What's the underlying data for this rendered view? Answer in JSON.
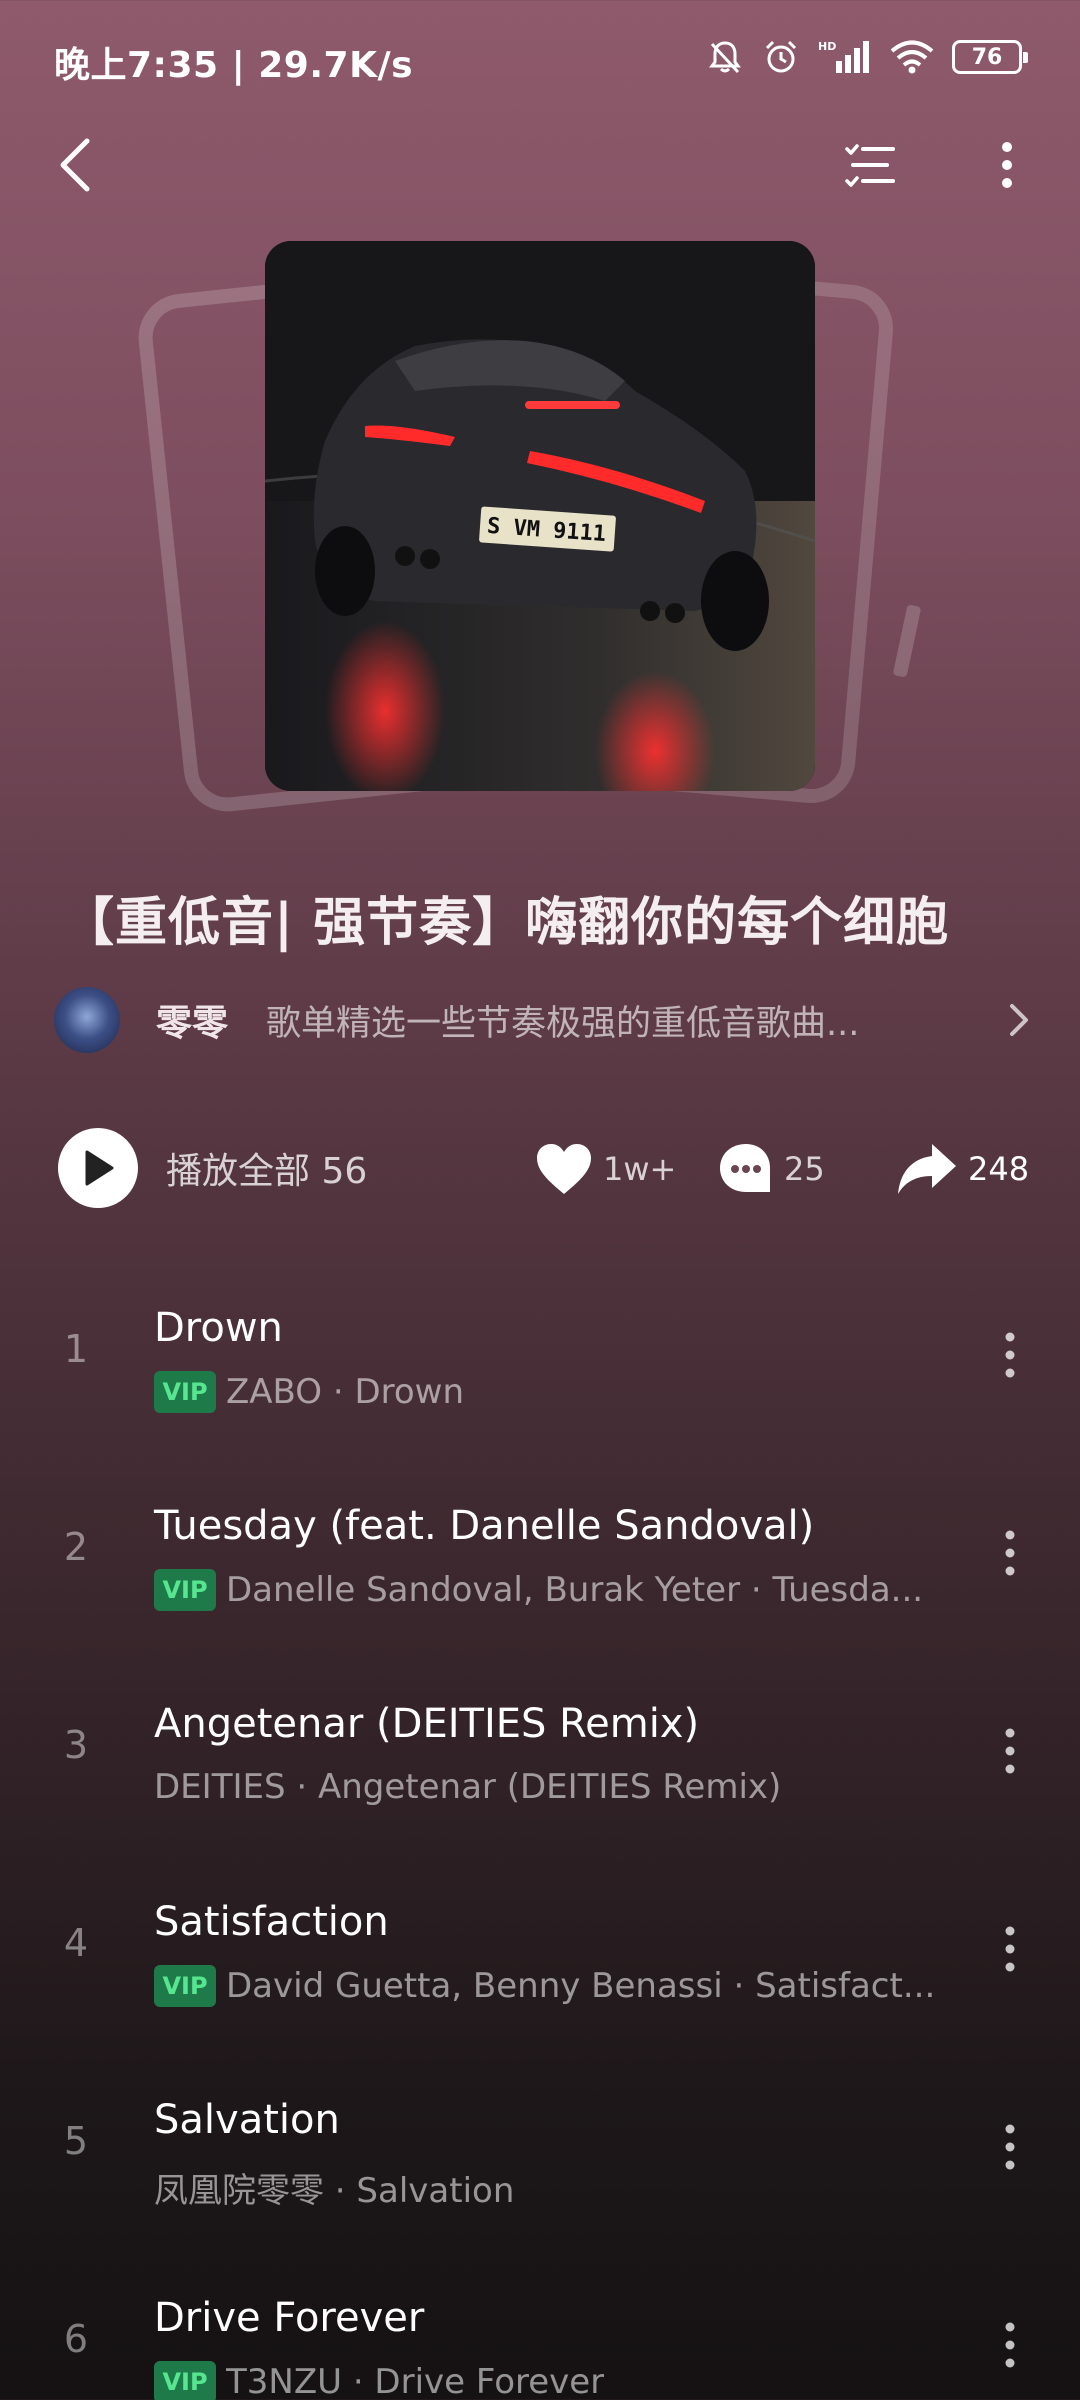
{
  "status_bar": {
    "time_speed": "晚上7:35 | 29.7K/s",
    "battery": "76",
    "hd": "HD"
  },
  "nav": {
    "back_icon": "chevron-left-icon",
    "list_icon": "list-check-icon",
    "more_icon": "more-vertical-icon"
  },
  "playlist": {
    "title": "【重低音| 强节奏】嗨翻你的每个细胞",
    "creator_name": "零零",
    "description": "歌单精选一些节奏极强的重低音歌曲...",
    "plate": "S VM 9111"
  },
  "actions": {
    "play_all_label": "播放全部",
    "track_count": "56",
    "likes": "1w+",
    "comments": "25",
    "shares": "248"
  },
  "songs": [
    {
      "index": "1",
      "title": "Drown",
      "vip": true,
      "meta": "ZABO · Drown"
    },
    {
      "index": "2",
      "title": "Tuesday (feat. Danelle Sandoval)",
      "vip": true,
      "meta": "Danelle Sandoval, Burak Yeter · Tuesda..."
    },
    {
      "index": "3",
      "title": "Angetenar (DEITIES Remix)",
      "vip": false,
      "meta": "DEITIES · Angetenar (DEITIES Remix)"
    },
    {
      "index": "4",
      "title": "Satisfaction",
      "vip": true,
      "meta": "David Guetta, Benny Benassi · Satisfact..."
    },
    {
      "index": "5",
      "title": "Salvation",
      "vip": false,
      "meta": "凤凰院零零 · Salvation"
    },
    {
      "index": "6",
      "title": "Drive Forever",
      "vip": true,
      "meta": "T3NZU · Drive Forever"
    }
  ],
  "vip_label": "VIP"
}
